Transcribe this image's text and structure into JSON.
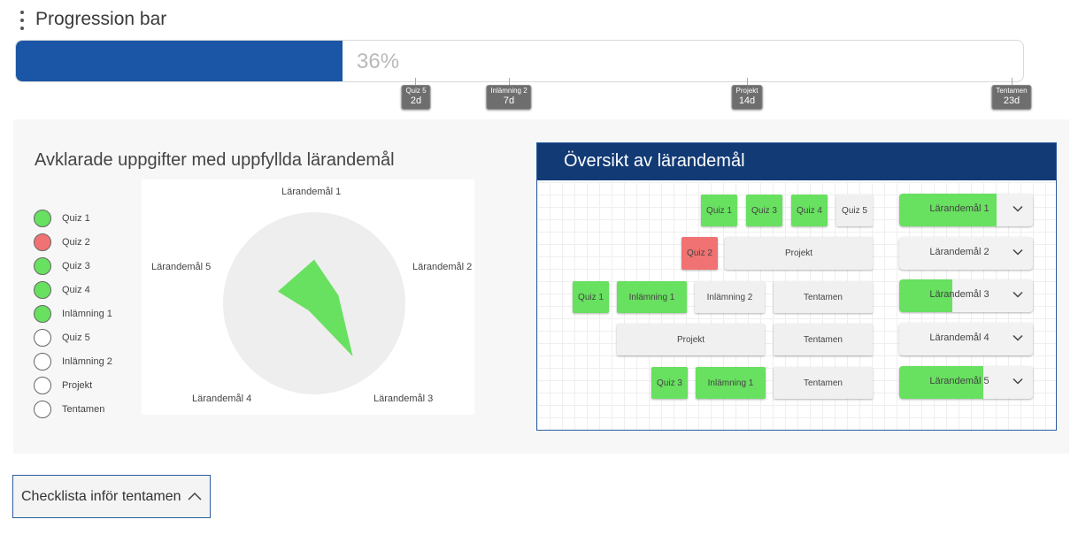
{
  "header": {
    "title": "Progression bar",
    "menu_icon": "kebab-menu-icon"
  },
  "progress": {
    "percent": 36,
    "label": "36%",
    "color": "#1b56a6",
    "milestones": [
      {
        "name": "Quiz 5",
        "days": "2d"
      },
      {
        "name": "Inlämning 2",
        "days": "7d"
      },
      {
        "name": "Projekt",
        "days": "14d"
      },
      {
        "name": "Tentamen",
        "days": "23d"
      }
    ]
  },
  "left_panel": {
    "title": "Avklarade uppgifter med uppfyllda lärandemål",
    "legend": [
      {
        "label": "Quiz 1",
        "status": "done",
        "color": "#68e060"
      },
      {
        "label": "Quiz 2",
        "status": "failed",
        "color": "#f17272"
      },
      {
        "label": "Quiz 3",
        "status": "done",
        "color": "#68e060"
      },
      {
        "label": "Quiz 4",
        "status": "done",
        "color": "#68e060"
      },
      {
        "label": "Inlämning 1",
        "status": "done",
        "color": "#68e060"
      },
      {
        "label": "Quiz 5",
        "status": "pending",
        "color": "#ffffff"
      },
      {
        "label": "Inlämning 2",
        "status": "pending",
        "color": "#ffffff"
      },
      {
        "label": "Projekt",
        "status": "pending",
        "color": "#ffffff"
      },
      {
        "label": "Tentamen",
        "status": "pending",
        "color": "#ffffff"
      }
    ],
    "radar": {
      "axes": [
        "Lärandemål 1",
        "Lärandemål 2",
        "Lärandemål 3",
        "Lärandemål 4",
        "Lärandemål 5"
      ],
      "values": [
        0.48,
        0.28,
        0.72,
        0.1,
        0.42
      ],
      "fill": "#68e060",
      "background": "#eeeeee"
    }
  },
  "right_panel": {
    "title": "Översikt av lärandemål",
    "header_color": "#123a75",
    "rows": [
      {
        "chips": [
          {
            "label": "Quiz 1",
            "status": "green"
          },
          {
            "label": "Quiz 3",
            "status": "green"
          },
          {
            "label": "Quiz 4",
            "status": "green"
          },
          {
            "label": "Quiz 5",
            "status": "grey"
          }
        ],
        "goal": {
          "label": "Lärandemål 1",
          "progress": 0.73
        }
      },
      {
        "chips": [
          {
            "label": "Quiz 2",
            "status": "red"
          },
          {
            "label": "Projekt",
            "status": "grey"
          }
        ],
        "goal": {
          "label": "Lärandemål 2",
          "progress": 0
        }
      },
      {
        "chips": [
          {
            "label": "Quiz 1",
            "status": "green"
          },
          {
            "label": "Inlämning 1",
            "status": "green"
          },
          {
            "label": "Inlämning 2",
            "status": "grey"
          },
          {
            "label": "Tentamen",
            "status": "grey"
          }
        ],
        "goal": {
          "label": "Lärandemål 3",
          "progress": 0.4
        }
      },
      {
        "chips": [
          {
            "label": "Projekt",
            "status": "grey"
          },
          {
            "label": "Tentamen",
            "status": "grey"
          }
        ],
        "goal": {
          "label": "Lärandemål 4",
          "progress": 0
        }
      },
      {
        "chips": [
          {
            "label": "Quiz 3",
            "status": "green"
          },
          {
            "label": "Inlämning 1",
            "status": "green"
          },
          {
            "label": "Tentamen",
            "status": "grey"
          }
        ],
        "goal": {
          "label": "Lärandemål 5",
          "progress": 0.63
        }
      }
    ]
  },
  "checklist": {
    "label": "Checklista inför tentamen",
    "icon": "chevron-up-icon"
  }
}
